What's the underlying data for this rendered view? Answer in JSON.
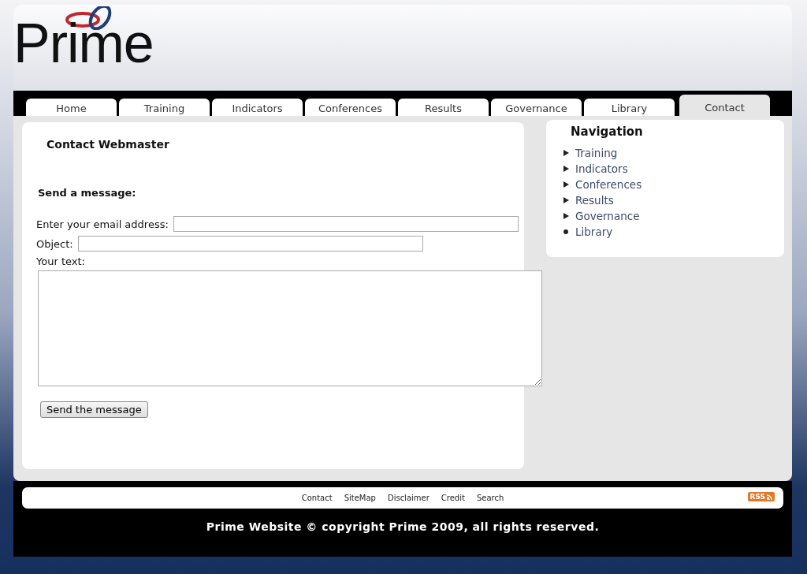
{
  "logo": {
    "text": "Prime"
  },
  "tabs": [
    {
      "label": "Home",
      "selected": false
    },
    {
      "label": "Training",
      "selected": false
    },
    {
      "label": "Indicators",
      "selected": false
    },
    {
      "label": "Conferences",
      "selected": false
    },
    {
      "label": "Results",
      "selected": false
    },
    {
      "label": "Governance",
      "selected": false
    },
    {
      "label": "Library",
      "selected": false
    },
    {
      "label": "Contact",
      "selected": true
    }
  ],
  "main": {
    "title": "Contact Webmaster",
    "subtitle": "Send a message:",
    "email_label": "Enter your email address:",
    "object_label": "Object:",
    "text_label": "Your text:",
    "send_button": "Send the message"
  },
  "navigation": {
    "title": "Navigation",
    "items": [
      {
        "label": "Training",
        "selected": false
      },
      {
        "label": "Indicators",
        "selected": false
      },
      {
        "label": "Conferences",
        "selected": false
      },
      {
        "label": "Results",
        "selected": false
      },
      {
        "label": "Governance",
        "selected": false
      },
      {
        "label": "Library",
        "selected": true
      }
    ]
  },
  "footer": {
    "links": [
      "Contact",
      "SiteMap",
      "Disclaimer",
      "Credit",
      "Search"
    ],
    "rss": "RSS",
    "copyright": "Prime Website © copyright Prime 2009, all rights reserved."
  }
}
